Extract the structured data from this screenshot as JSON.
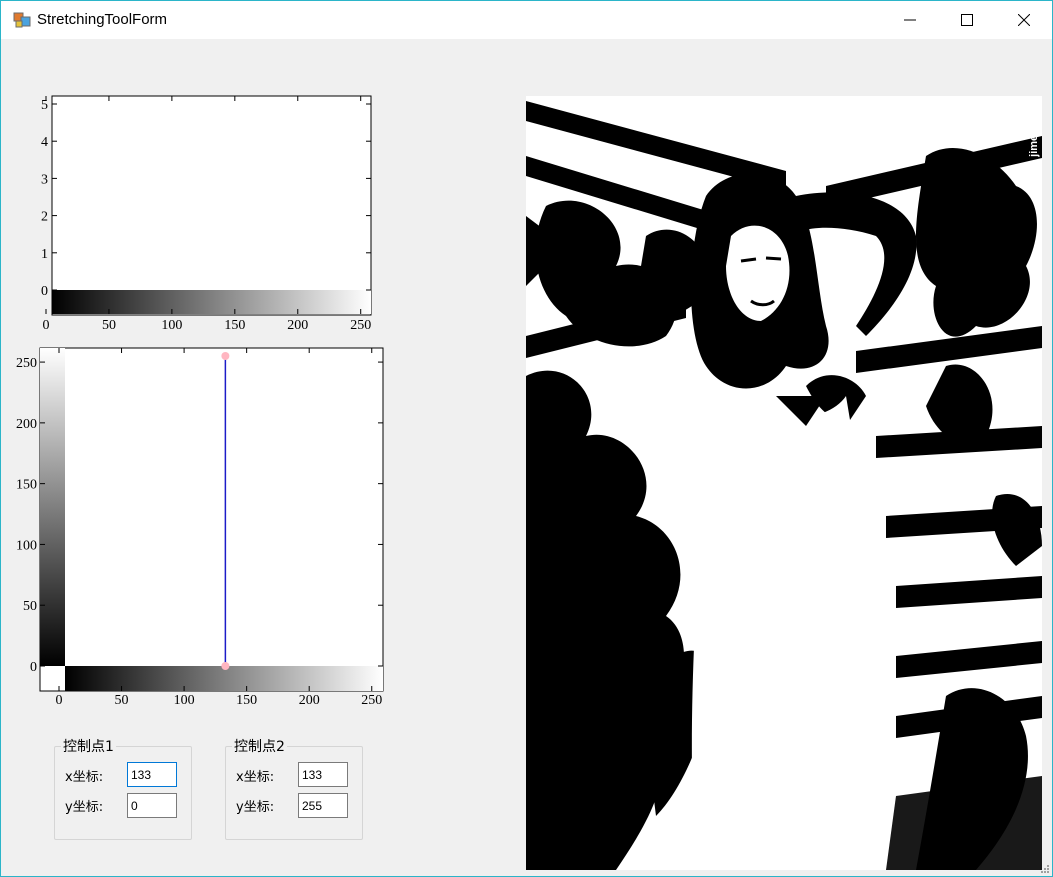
{
  "window": {
    "title": "StretchingToolForm"
  },
  "histogram": {
    "y_ticks": [
      "5",
      "4",
      "3",
      "2",
      "1",
      "0"
    ],
    "x_ticks": [
      "0",
      "50",
      "100",
      "150",
      "200",
      "250"
    ]
  },
  "curve": {
    "y_ticks": [
      "250",
      "200",
      "150",
      "100",
      "50",
      "0"
    ],
    "x_ticks": [
      "0",
      "50",
      "100",
      "150",
      "200",
      "250"
    ],
    "line_color": "#1c1cc8",
    "point_color": "#ffb6c1"
  },
  "chart_data": [
    {
      "type": "bar",
      "ylim": [
        0,
        5
      ],
      "xlim": [
        0,
        255
      ],
      "values": []
    },
    {
      "type": "line",
      "xlim": [
        0,
        255
      ],
      "ylim": [
        0,
        255
      ],
      "series": [
        {
          "x": [
            133,
            133
          ],
          "y": [
            0,
            255
          ]
        }
      ]
    }
  ],
  "control_point_1": {
    "title": "控制点1",
    "x_label": "x坐标:",
    "y_label": "y坐标:",
    "x_value": "133",
    "y_value": "0"
  },
  "control_point_2": {
    "title": "控制点2",
    "x_label": "x坐标:",
    "y_label": "y坐标:",
    "x_value": "133",
    "y_value": "255"
  },
  "image": {
    "watermark": "jimeise.net"
  }
}
